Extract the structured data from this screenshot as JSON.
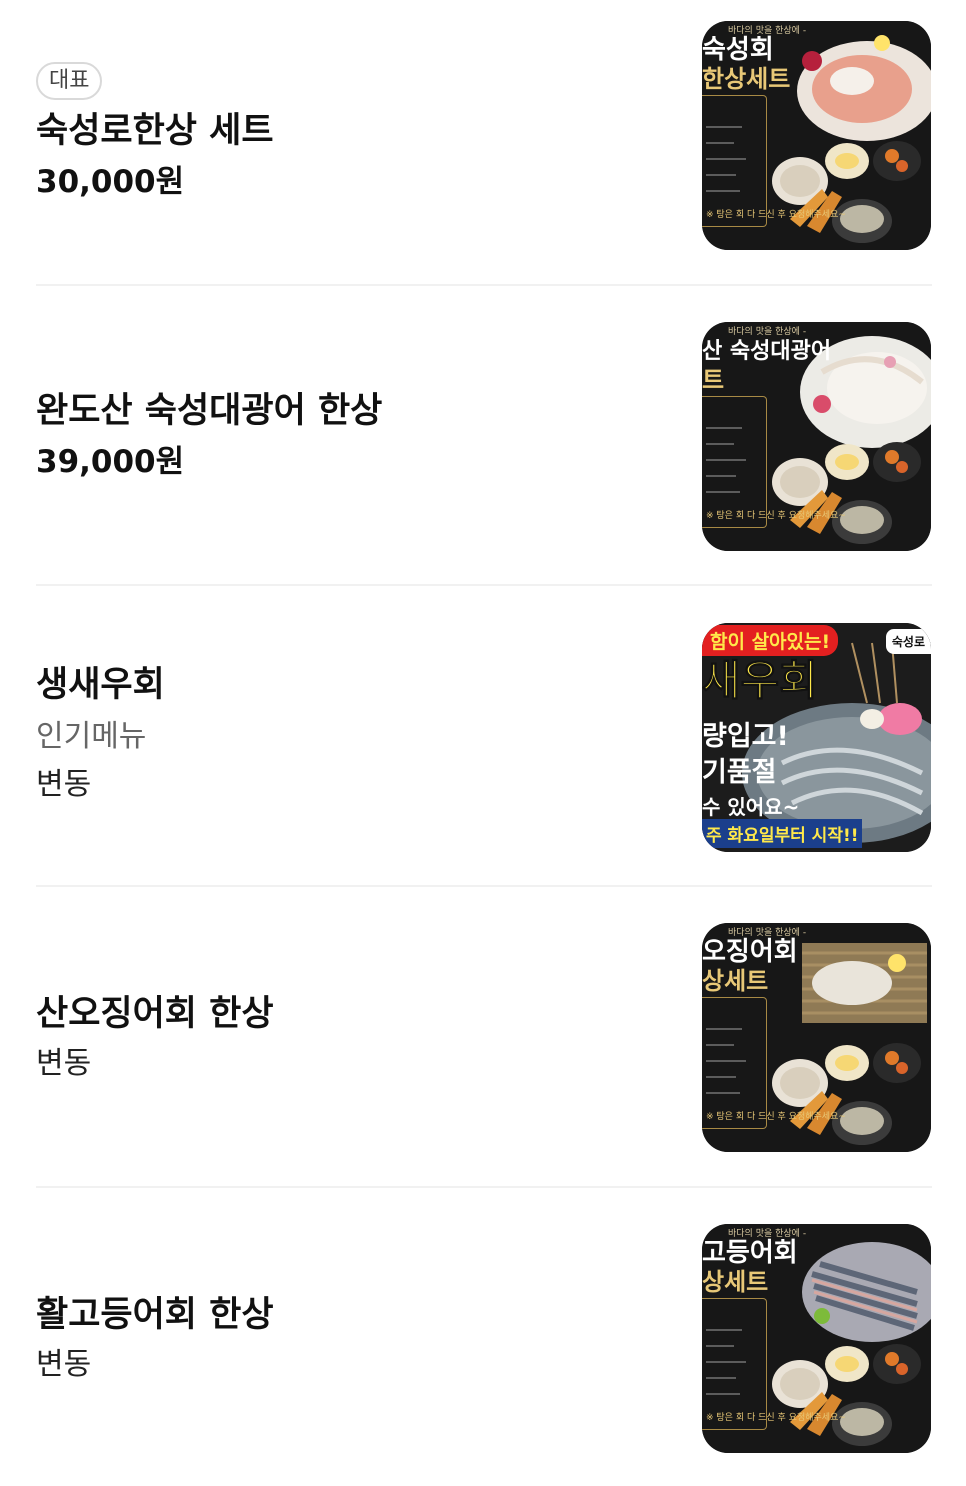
{
  "colors": {
    "text_primary": "#111111",
    "text_secondary": "#666666",
    "badge_border": "#d9d9d9",
    "divider": "#f1f1f1",
    "thumb_background": "#161616",
    "thumb_accent_gold": "#e8c877",
    "promo_yellow": "#ffe94a",
    "promo_red": "#e32020"
  },
  "menu": {
    "items": [
      {
        "badge": "대표",
        "name": "숙성로한상 세트",
        "price": "30,000원",
        "image": {
          "top": "바다의 맛을 한상에 -",
          "title": "숙성회",
          "subtitle": "한상세트",
          "tag": "※ 탕은 회 다 드신 후 요청해주세요~"
        }
      },
      {
        "name": "완도산 숙성대광어 한상",
        "price": "39,000원",
        "image": {
          "top": "바다의 맛을 한상에 -",
          "title": "산 숙성대광어",
          "subtitle": "트",
          "tag": "※ 탕은 회 다 드신 후 요청해주세요~"
        }
      },
      {
        "name": "생새우회",
        "description": "인기메뉴",
        "price": "변동",
        "image": {
          "pill": "함이 살아있는!",
          "title": "새우회",
          "line1": "량입고!",
          "line2": "기품절",
          "line3": "수 있어요~",
          "line4": "주 화요일부터 시작!!",
          "badge": "숙성로"
        }
      },
      {
        "name": "산오징어회 한상",
        "price": "변동",
        "image": {
          "top": "바다의 맛을 한상에 -",
          "title": "오징어회",
          "subtitle": "상세트",
          "tag": "※ 탕은 회 다 드신 후 요청해주세요~"
        }
      },
      {
        "name": "활고등어회 한상",
        "price": "변동",
        "image": {
          "top": "바다의 맛을 한상에 -",
          "title": "고등어회",
          "subtitle": "상세트",
          "tag": "※ 탕은 회 다 드신 후 요청해주세요~"
        }
      }
    ]
  }
}
